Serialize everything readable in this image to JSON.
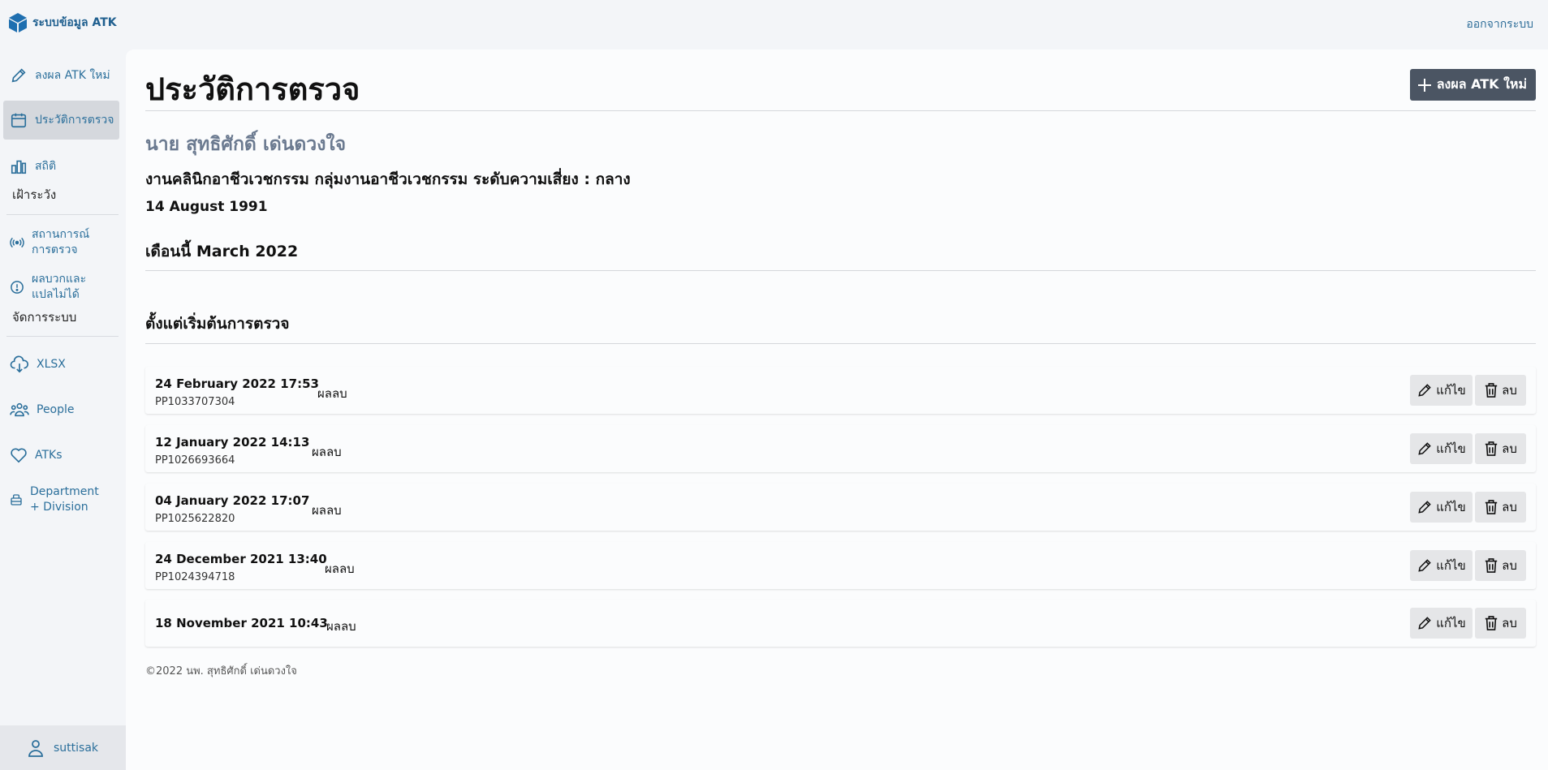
{
  "app": {
    "brand": "ระบบข้อมูล ATK",
    "logout_label": "ออกจากระบบ"
  },
  "sidebar": {
    "new_result": "ลงผล ATK ใหม่",
    "history": "ประวัติการตรวจ",
    "stats": "สถิติ",
    "watch_section": "เฝ้าระวัง",
    "test_status": "สถานการณ์การตรวจ",
    "positive_unclear": "ผลบวกและแปลไม่ได้",
    "admin_section": "จัดการระบบ",
    "xlsx": "XLSX",
    "people": "People",
    "atks": "ATKs",
    "department": "Department + Division",
    "user": "suttisak"
  },
  "main": {
    "title": "ประวัติการตรวจ",
    "add_button": "ลงผล ATK ใหม่",
    "person_name": "นาย สุทธิศักดิ์ เด่นดวงใจ",
    "person_dept": "งานคลินิกอาชีวเวชกรรม กลุ่มงานอาชีวเวชกรรม ระดับความเสี่ยง : กลาง",
    "person_dob": "14 August 1991",
    "this_month": "เดือนนี้ March 2022",
    "since_start": "ตั้งแต่เริ่มต้นการตรวจ",
    "edit_label": "แก้ไข",
    "delete_label": "ลบ",
    "records": [
      {
        "date": "24 February 2022 17:53",
        "id": "PP1033707304",
        "result": "ผลลบ"
      },
      {
        "date": "12 January 2022 14:13",
        "id": "PP1026693664",
        "result": "ผลลบ"
      },
      {
        "date": "04 January 2022 17:07",
        "id": "PP1025622820",
        "result": "ผลลบ"
      },
      {
        "date": "24 December 2021 13:40",
        "id": "PP1024394718",
        "result": "ผลลบ"
      },
      {
        "date": "18 November 2021 10:43",
        "id": "",
        "result": "ผลลบ"
      }
    ],
    "footer": "©2022 นพ. สุทธิศักดิ์ เด่นดวงใจ"
  },
  "colors": {
    "accent": "#2b6f9b",
    "brand": "#1f5f8f",
    "primary_button": "#4b5563",
    "name_gray": "#6b7a90"
  }
}
